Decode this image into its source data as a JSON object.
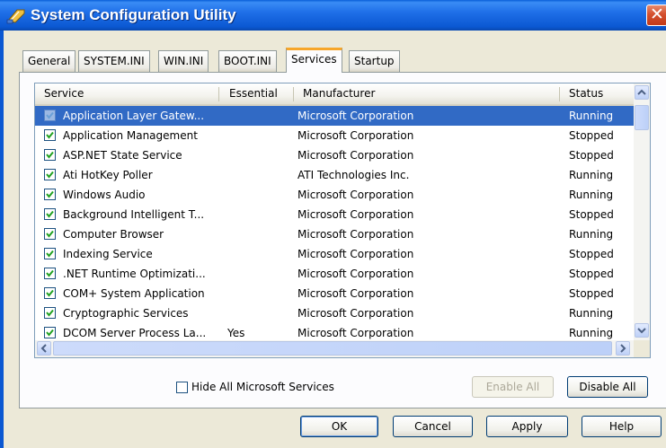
{
  "window": {
    "title": "System Configuration Utility",
    "close_glyph": "✕"
  },
  "tabs": [
    {
      "label": "General"
    },
    {
      "label": "SYSTEM.INI"
    },
    {
      "label": "WIN.INI"
    },
    {
      "label": "BOOT.INI"
    },
    {
      "label": "Services",
      "active": true
    },
    {
      "label": "Startup"
    }
  ],
  "list": {
    "columns": {
      "service": "Service",
      "essential": "Essential",
      "manufacturer": "Manufacturer",
      "status": "Status"
    },
    "rows": [
      {
        "service": "Application Layer Gatew...",
        "essential": "",
        "manufacturer": "Microsoft Corporation",
        "status": "Running",
        "checked": true,
        "selected": true
      },
      {
        "service": "Application Management",
        "essential": "",
        "manufacturer": "Microsoft Corporation",
        "status": "Stopped",
        "checked": true
      },
      {
        "service": "ASP.NET State Service",
        "essential": "",
        "manufacturer": "Microsoft Corporation",
        "status": "Stopped",
        "checked": true
      },
      {
        "service": "Ati HotKey Poller",
        "essential": "",
        "manufacturer": "ATI Technologies Inc.",
        "status": "Running",
        "checked": true
      },
      {
        "service": "Windows Audio",
        "essential": "",
        "manufacturer": "Microsoft Corporation",
        "status": "Running",
        "checked": true
      },
      {
        "service": "Background Intelligent T...",
        "essential": "",
        "manufacturer": "Microsoft Corporation",
        "status": "Stopped",
        "checked": true
      },
      {
        "service": "Computer Browser",
        "essential": "",
        "manufacturer": "Microsoft Corporation",
        "status": "Running",
        "checked": true
      },
      {
        "service": "Indexing Service",
        "essential": "",
        "manufacturer": "Microsoft Corporation",
        "status": "Stopped",
        "checked": true
      },
      {
        "service": ".NET Runtime Optimizati...",
        "essential": "",
        "manufacturer": "Microsoft Corporation",
        "status": "Stopped",
        "checked": true
      },
      {
        "service": "COM+ System Application",
        "essential": "",
        "manufacturer": "Microsoft Corporation",
        "status": "Stopped",
        "checked": true
      },
      {
        "service": "Cryptographic Services",
        "essential": "",
        "manufacturer": "Microsoft Corporation",
        "status": "Running",
        "checked": true
      },
      {
        "service": "DCOM Server Process La...",
        "essential": "Yes",
        "manufacturer": "Microsoft Corporation",
        "status": "Running",
        "checked": true
      }
    ]
  },
  "controls": {
    "hide_ms_label": "Hide All Microsoft Services",
    "enable_all": "Enable All",
    "disable_all": "Disable All"
  },
  "footer": {
    "ok": "OK",
    "cancel": "Cancel",
    "apply": "Apply",
    "help": "Help"
  },
  "colors": {
    "selection": "#316ac5",
    "titlebar": "#0b58d2",
    "active_tab_accent": "#f7a62a"
  }
}
